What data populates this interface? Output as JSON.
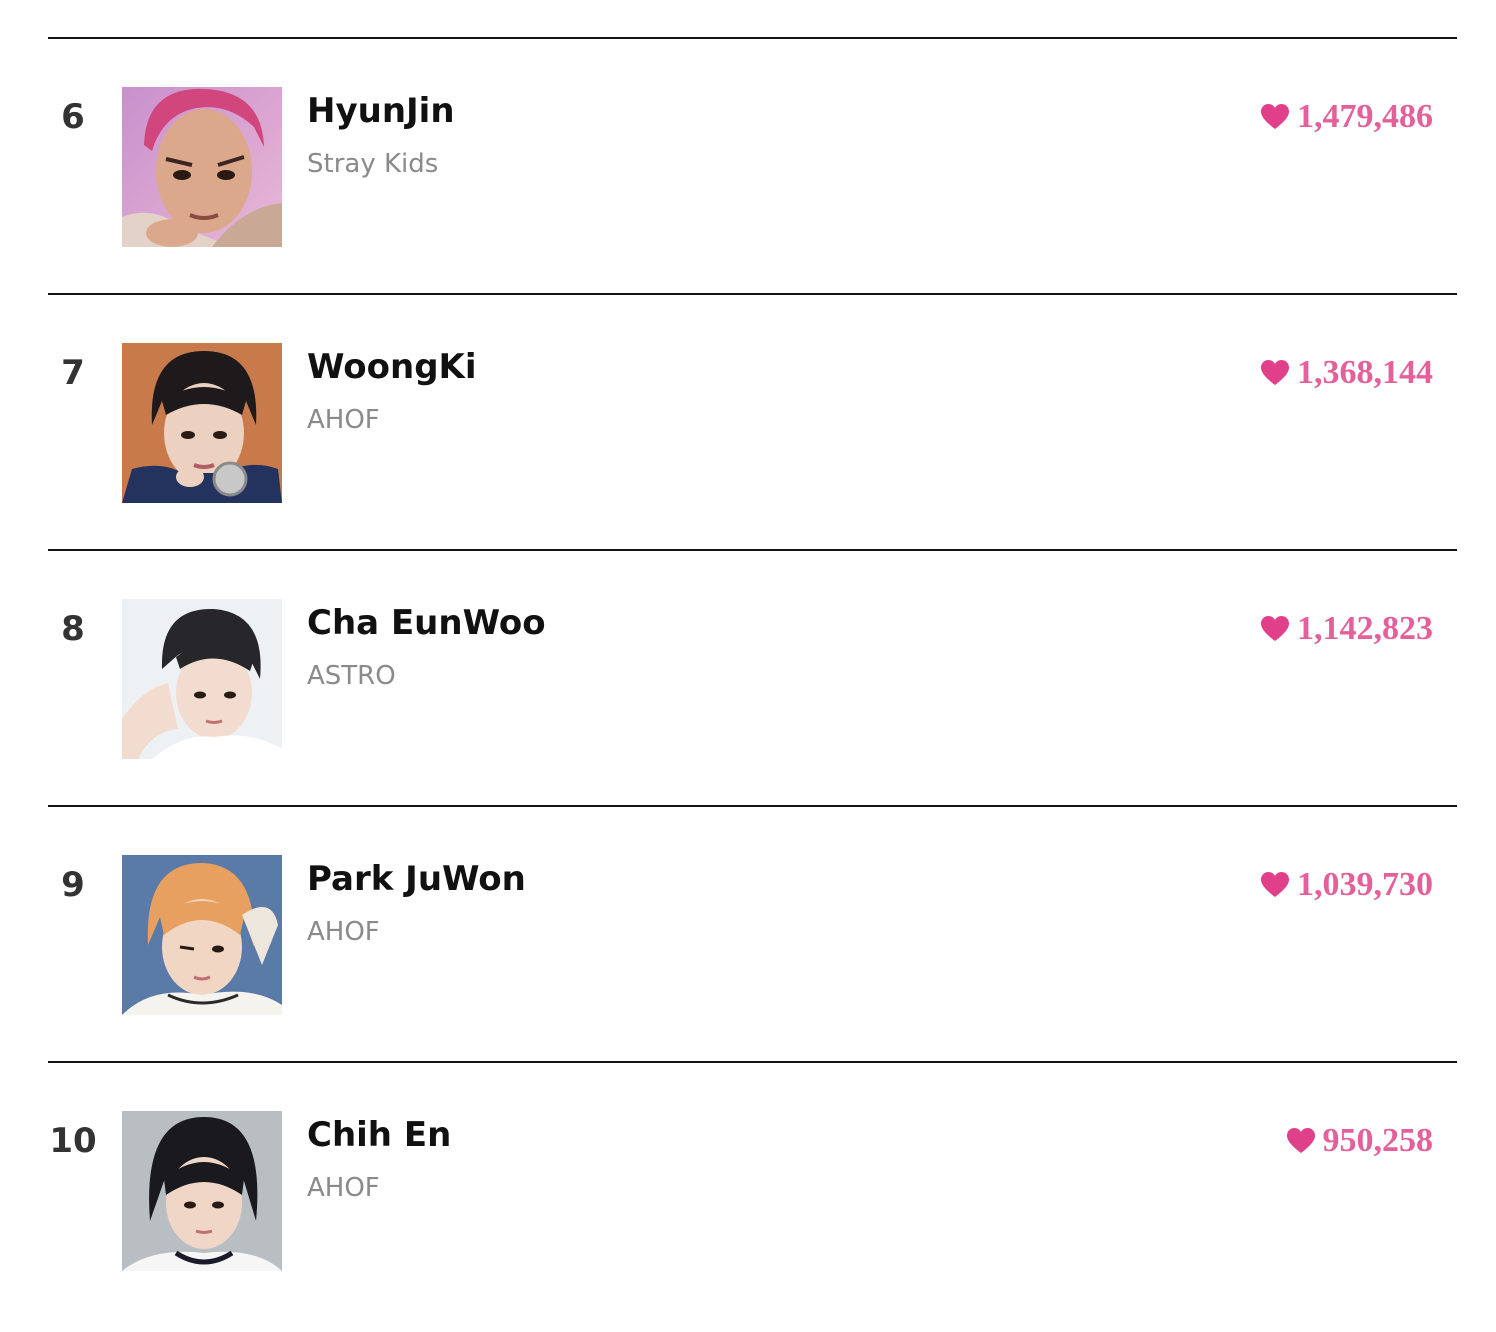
{
  "ranking": {
    "accent_color": "#e4609a",
    "items": [
      {
        "rank": "6",
        "name": "HyunJin",
        "group": "Stray Kids",
        "votes": "1,479,486",
        "photo_icon": "artist-photo",
        "heart_icon": "heart-icon"
      },
      {
        "rank": "7",
        "name": "WoongKi",
        "group": "AHOF",
        "votes": "1,368,144",
        "photo_icon": "artist-photo",
        "heart_icon": "heart-icon"
      },
      {
        "rank": "8",
        "name": "Cha EunWoo",
        "group": "ASTRO",
        "votes": "1,142,823",
        "photo_icon": "artist-photo",
        "heart_icon": "heart-icon"
      },
      {
        "rank": "9",
        "name": "Park JuWon",
        "group": "AHOF",
        "votes": "1,039,730",
        "photo_icon": "artist-photo",
        "heart_icon": "heart-icon"
      },
      {
        "rank": "10",
        "name": "Chih En",
        "group": "AHOF",
        "votes": "950,258",
        "photo_icon": "artist-photo",
        "heart_icon": "heart-icon"
      }
    ]
  }
}
